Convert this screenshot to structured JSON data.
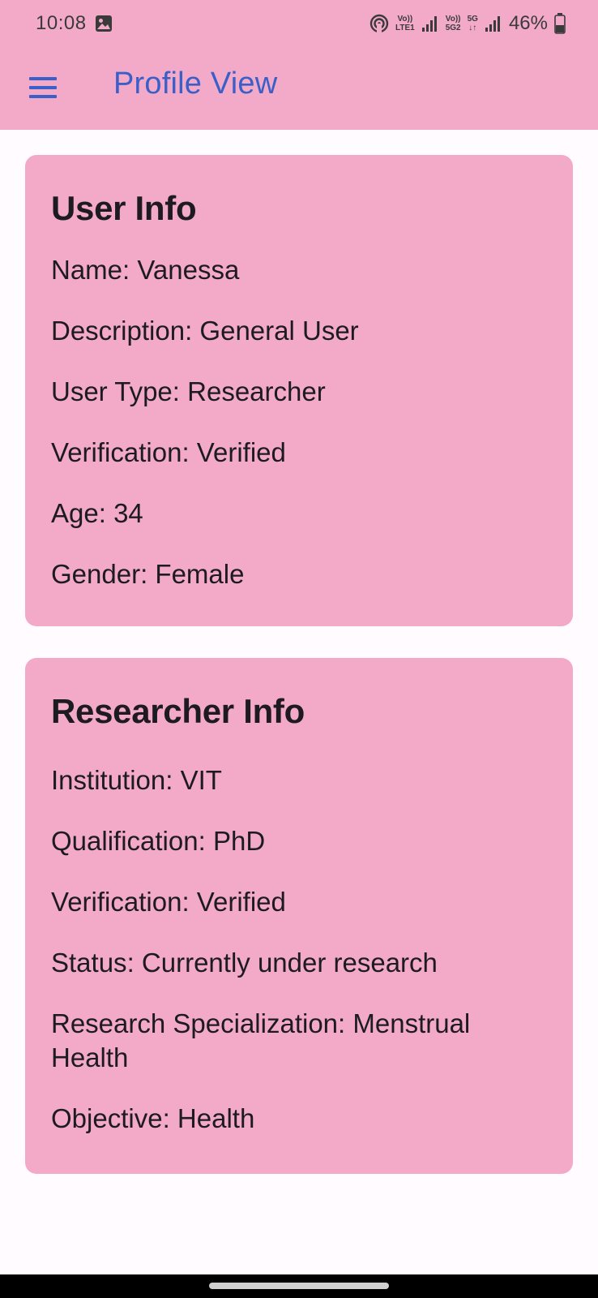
{
  "status_bar": {
    "time": "10:08",
    "net1_top": "Vo))",
    "net1_bottom": "LTE1",
    "net2_top": "Vo))",
    "net2_bottom": "5G2",
    "net3_top": "5G",
    "net3_bottom": "↓↑",
    "battery_percent": "46%",
    "battery_level": 0.46,
    "icons": [
      "gallery-icon",
      "hotspot-icon",
      "signal-icon",
      "battery-icon"
    ]
  },
  "app_bar": {
    "title": "Profile View",
    "menu_icon": "menu-icon",
    "accent_color": "#3a5fc8",
    "background_color": "#f3aac8"
  },
  "user_info": {
    "title": "User Info",
    "rows": [
      {
        "label": "Name",
        "value": "Vanessa"
      },
      {
        "label": "Description",
        "value": "General User"
      },
      {
        "label": "User Type",
        "value": "Researcher"
      },
      {
        "label": "Verification",
        "value": "Verified"
      },
      {
        "label": "Age",
        "value": "34"
      },
      {
        "label": "Gender",
        "value": "Female"
      }
    ]
  },
  "researcher_info": {
    "title": "Researcher Info",
    "rows": [
      {
        "label": "Institution",
        "value": "VIT"
      },
      {
        "label": "Qualification",
        "value": "PhD"
      },
      {
        "label": "Verification",
        "value": "Verified"
      },
      {
        "label": "Status",
        "value": "Currently under research"
      },
      {
        "label": "Research Specialization",
        "value": "Menstrual Health"
      },
      {
        "label": "Objective",
        "value": "Health"
      }
    ]
  }
}
